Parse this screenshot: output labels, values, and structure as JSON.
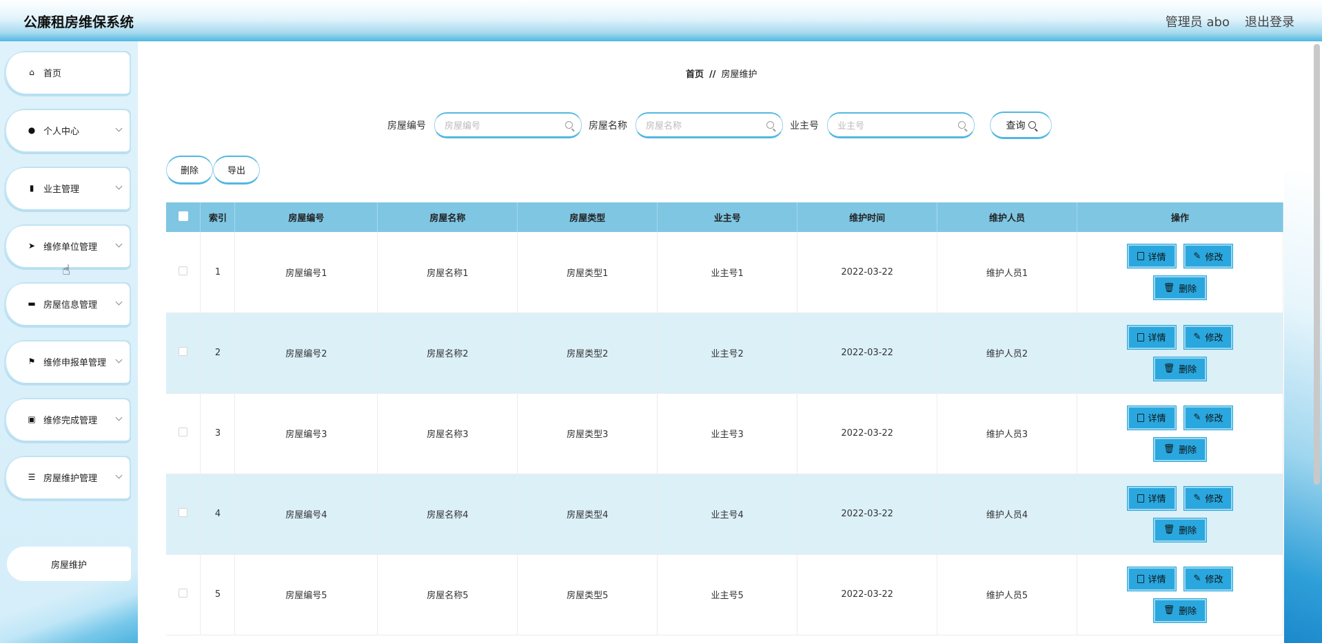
{
  "header": {
    "title": "公廉租房维保系统",
    "user": "管理员 abo",
    "logout": "退出登录"
  },
  "sidebar": {
    "items": [
      {
        "label": "首页",
        "icon": "home-icon",
        "glyph": "⌂",
        "has_chevron": false
      },
      {
        "label": "个人中心",
        "icon": "person-icon",
        "glyph": "●",
        "has_chevron": true
      },
      {
        "label": "业主管理",
        "icon": "bar-chart-icon",
        "glyph": "▮",
        "has_chevron": true
      },
      {
        "label": "维修单位管理",
        "icon": "send-icon",
        "glyph": "➤",
        "has_chevron": true
      },
      {
        "label": "房屋信息管理",
        "icon": "house-icon",
        "glyph": "▬",
        "has_chevron": true
      },
      {
        "label": "维修申报单管理",
        "icon": "flag-icon",
        "glyph": "⚑",
        "has_chevron": true
      },
      {
        "label": "维修完成管理",
        "icon": "clipboard-icon",
        "glyph": "▣",
        "has_chevron": true
      },
      {
        "label": "房屋维护管理",
        "icon": "menu-icon",
        "glyph": "☰",
        "has_chevron": true
      }
    ],
    "sub_item": "房屋维护"
  },
  "breadcrumb": {
    "home": "首页",
    "sep": "//",
    "current": "房屋维护"
  },
  "search": {
    "field1_label": "房屋编号",
    "field1_placeholder": "房屋编号",
    "field2_label": "房屋名称",
    "field2_placeholder": "房屋名称",
    "field3_label": "业主号",
    "field3_placeholder": "业主号",
    "button": "查询"
  },
  "toolbar": {
    "delete": "删除",
    "export": "导出"
  },
  "table": {
    "headers": [
      "索引",
      "房屋编号",
      "房屋名称",
      "房屋类型",
      "业主号",
      "维护时间",
      "维护人员",
      "操作"
    ],
    "rows": [
      [
        "1",
        "房屋编号1",
        "房屋名称1",
        "房屋类型1",
        "业主号1",
        "2022-03-22",
        "维护人员1"
      ],
      [
        "2",
        "房屋编号2",
        "房屋名称2",
        "房屋类型2",
        "业主号2",
        "2022-03-22",
        "维护人员2"
      ],
      [
        "3",
        "房屋编号3",
        "房屋名称3",
        "房屋类型3",
        "业主号3",
        "2022-03-22",
        "维护人员3"
      ],
      [
        "4",
        "房屋编号4",
        "房屋名称4",
        "房屋类型4",
        "业主号4",
        "2022-03-22",
        "维护人员4"
      ],
      [
        "5",
        "房屋编号5",
        "房屋名称5",
        "房屋类型5",
        "业主号5",
        "2022-03-22",
        "维护人员5"
      ]
    ],
    "actions": {
      "detail": "详情",
      "edit": "修改",
      "delete": "删除"
    }
  },
  "colors": {
    "accent": "#29a7de",
    "header_row": "#7fc6e3",
    "alt_row": "#dcf0f8"
  }
}
